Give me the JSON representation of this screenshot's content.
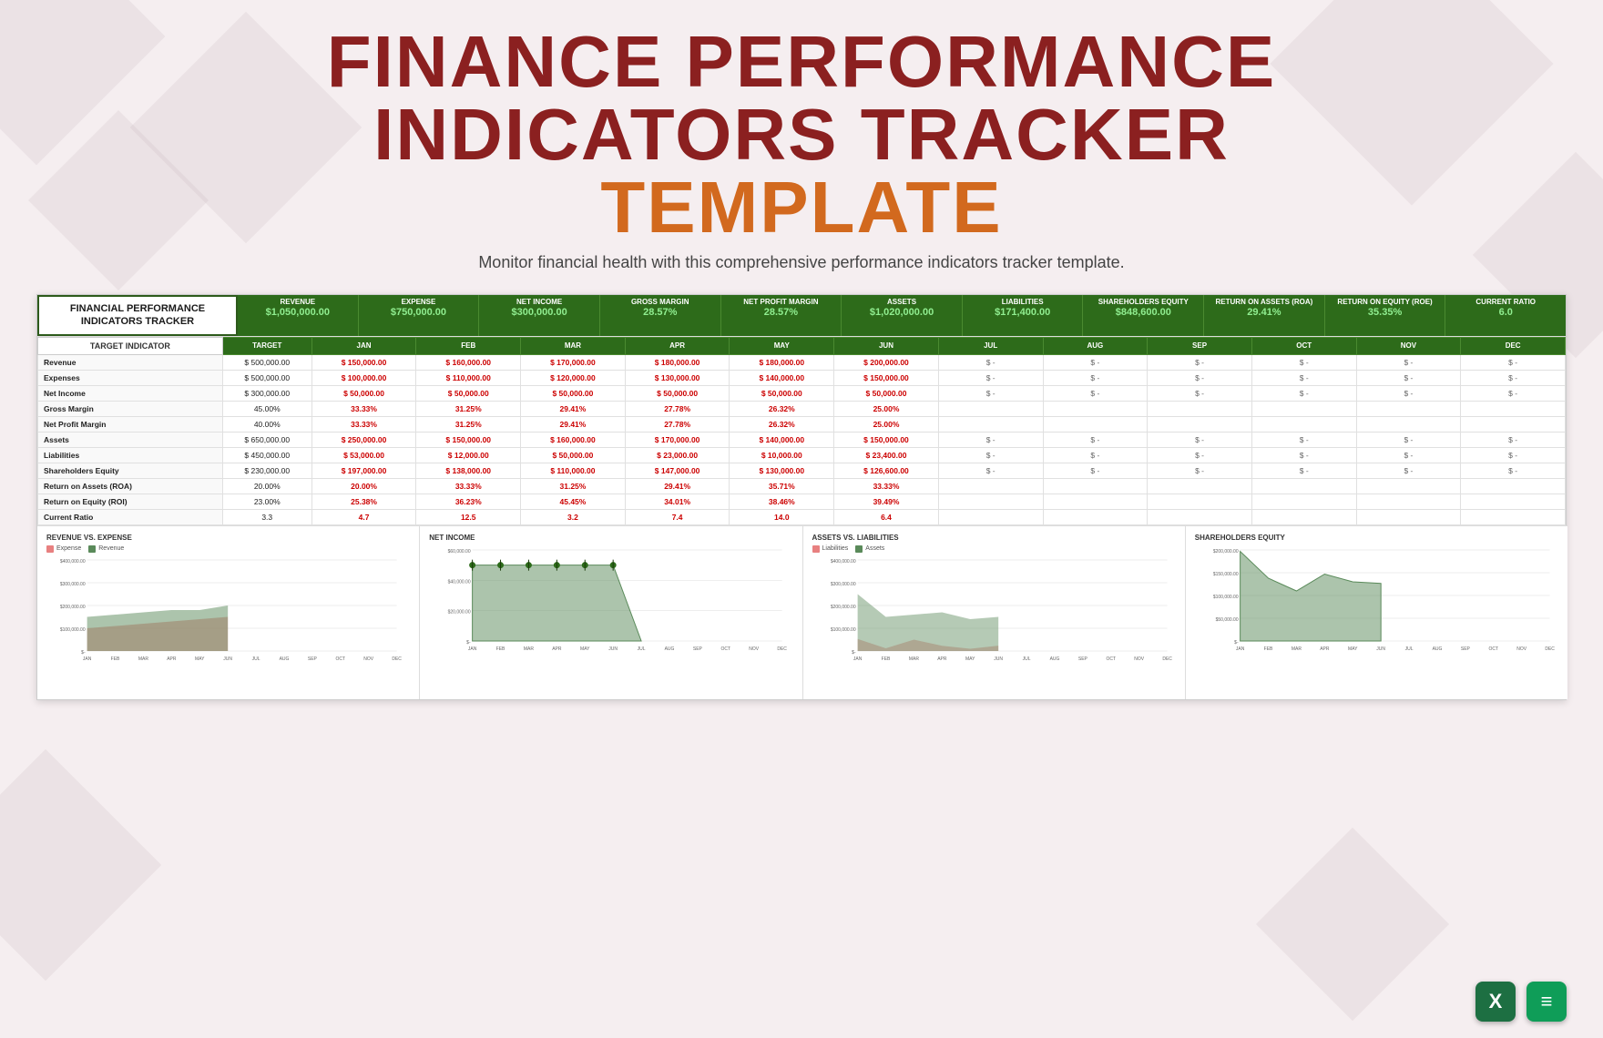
{
  "page": {
    "title_line1": "FINANCE PERFORMANCE",
    "title_line2": "INDICATORS TRACKER",
    "title_highlight": "TEMPLATE",
    "subtitle": "Monitor financial health with this comprehensive performance indicators tracker template."
  },
  "tracker_title_line1": "FINANCIAL PERFORMANCE",
  "tracker_title_line2": "INDICATORS TRACKER",
  "summary_metrics": [
    {
      "label": "REVENUE",
      "value": "$1,050,000.00"
    },
    {
      "label": "EXPENSE",
      "value": "$750,000.00"
    },
    {
      "label": "NET INCOME",
      "value": "$300,000.00"
    },
    {
      "label": "GROSS MARGIN",
      "value": "28.57%"
    },
    {
      "label": "NET PROFIT MARGIN",
      "value": "28.57%"
    },
    {
      "label": "ASSETS",
      "value": "$1,020,000.00"
    },
    {
      "label": "LIABILITIES",
      "value": "$171,400.00"
    },
    {
      "label": "SHAREHOLDERS EQUITY",
      "value": "$848,600.00"
    },
    {
      "label": "RETURN ON ASSETS (ROA)",
      "value": "29.41%"
    },
    {
      "label": "RETURN ON EQUITY (ROE)",
      "value": "35.35%"
    },
    {
      "label": "CURRENT RATIO",
      "value": "6.0"
    }
  ],
  "table_headers": {
    "indicator": "TARGET INDICATOR",
    "months": [
      "JAN",
      "FEB",
      "MAR",
      "APR",
      "MAY",
      "JUN",
      "JUL",
      "AUG",
      "SEP",
      "OCT",
      "NOV",
      "DEC"
    ]
  },
  "rows": [
    {
      "label": "Revenue",
      "target": "$ 500,000.00",
      "jan": "$ 150,000.00",
      "feb": "$ 160,000.00",
      "mar": "$ 170,000.00",
      "apr": "$ 180,000.00",
      "may": "$ 180,000.00",
      "jun": "$ 200,000.00",
      "jul": "$  -",
      "aug": "$  -",
      "sep": "$  -",
      "oct": "$  -",
      "nov": "$  -",
      "dec": "$  -",
      "type": "currency"
    },
    {
      "label": "Expenses",
      "target": "$ 500,000.00",
      "jan": "$ 100,000.00",
      "feb": "$ 110,000.00",
      "mar": "$ 120,000.00",
      "apr": "$ 130,000.00",
      "may": "$ 140,000.00",
      "jun": "$ 150,000.00",
      "jul": "$  -",
      "aug": "$  -",
      "sep": "$  -",
      "oct": "$  -",
      "nov": "$  -",
      "dec": "$  -",
      "type": "currency"
    },
    {
      "label": "Net Income",
      "target": "$ 300,000.00",
      "jan": "$ 50,000.00",
      "feb": "$ 50,000.00",
      "mar": "$ 50,000.00",
      "apr": "$ 50,000.00",
      "may": "$ 50,000.00",
      "jun": "$ 50,000.00",
      "jul": "$  -",
      "aug": "$  -",
      "sep": "$  -",
      "oct": "$  -",
      "nov": "$  -",
      "dec": "$  -",
      "type": "currency"
    },
    {
      "label": "Gross Margin",
      "target": "45.00%",
      "jan": "33.33%",
      "feb": "31.25%",
      "mar": "29.41%",
      "apr": "27.78%",
      "may": "26.32%",
      "jun": "25.00%",
      "jul": "",
      "aug": "",
      "sep": "",
      "oct": "",
      "nov": "",
      "dec": "",
      "type": "percent"
    },
    {
      "label": "Net Profit Margin",
      "target": "40.00%",
      "jan": "33.33%",
      "feb": "31.25%",
      "mar": "29.41%",
      "apr": "27.78%",
      "may": "26.32%",
      "jun": "25.00%",
      "jul": "",
      "aug": "",
      "sep": "",
      "oct": "",
      "nov": "",
      "dec": "",
      "type": "percent"
    },
    {
      "label": "Assets",
      "target": "$ 650,000.00",
      "jan": "$ 250,000.00",
      "feb": "$ 150,000.00",
      "mar": "$ 160,000.00",
      "apr": "$ 170,000.00",
      "may": "$ 140,000.00",
      "jun": "$ 150,000.00",
      "jul": "$  -",
      "aug": "$  -",
      "sep": "$  -",
      "oct": "$  -",
      "nov": "$  -",
      "dec": "$  -",
      "type": "currency"
    },
    {
      "label": "Liabilities",
      "target": "$ 450,000.00",
      "jan": "$ 53,000.00",
      "feb": "$ 12,000.00",
      "mar": "$ 50,000.00",
      "apr": "$ 23,000.00",
      "may": "$ 10,000.00",
      "jun": "$ 23,400.00",
      "jul": "$  -",
      "aug": "$  -",
      "sep": "$  -",
      "oct": "$  -",
      "nov": "$  -",
      "dec": "$  -",
      "type": "currency"
    },
    {
      "label": "Shareholders Equity",
      "target": "$ 230,000.00",
      "jan": "$ 197,000.00",
      "feb": "$ 138,000.00",
      "mar": "$ 110,000.00",
      "apr": "$ 147,000.00",
      "may": "$ 130,000.00",
      "jun": "$ 126,600.00",
      "jul": "$  -",
      "aug": "$  -",
      "sep": "$  -",
      "oct": "$  -",
      "nov": "$  -",
      "dec": "$  -",
      "type": "currency"
    },
    {
      "label": "Return on Assets (ROA)",
      "target": "20.00%",
      "jan": "20.00%",
      "feb": "33.33%",
      "mar": "31.25%",
      "apr": "29.41%",
      "may": "35.71%",
      "jun": "33.33%",
      "jul": "",
      "aug": "",
      "sep": "",
      "oct": "",
      "nov": "",
      "dec": "",
      "type": "percent"
    },
    {
      "label": "Return on Equity (ROI)",
      "target": "23.00%",
      "jan": "25.38%",
      "feb": "36.23%",
      "mar": "45.45%",
      "apr": "34.01%",
      "may": "38.46%",
      "jun": "39.49%",
      "jul": "",
      "aug": "",
      "sep": "",
      "oct": "",
      "nov": "",
      "dec": "",
      "type": "percent"
    },
    {
      "label": "Current Ratio",
      "target": "3.3",
      "jan": "4.7",
      "feb": "12.5",
      "mar": "3.2",
      "apr": "7.4",
      "may": "14.0",
      "jun": "6.4",
      "jul": "",
      "aug": "",
      "sep": "",
      "oct": "",
      "nov": "",
      "dec": "",
      "type": "ratio"
    }
  ],
  "charts": [
    {
      "title": "REVENUE VS. EXPENSE",
      "legend": [
        {
          "label": "Expense",
          "color": "#e88080"
        },
        {
          "label": "Revenue",
          "color": "#5a8a5a"
        }
      ],
      "y_labels": [
        "$400,000.00",
        "$300,000.00",
        "$200,000.00",
        "$100,000.00",
        "$-"
      ],
      "x_labels": [
        "JAN",
        "FEB",
        "MAR",
        "APR",
        "MAY",
        "JUN",
        "JUL",
        "AUG",
        "SEP",
        "OCT",
        "NOV",
        "DEC"
      ]
    },
    {
      "title": "NET INCOME",
      "y_labels": [
        "$60,000.00",
        "$40,000.00",
        "$20,000.00",
        "$-"
      ],
      "x_labels": [
        "JAN",
        "FEB",
        "MAR",
        "APR",
        "MAY",
        "JUN",
        "JUL",
        "AUG",
        "SEP",
        "OCT",
        "NOV",
        "DEC"
      ]
    },
    {
      "title": "ASSETS VS. LIABILITIES",
      "legend": [
        {
          "label": "Liabilities",
          "color": "#e88080"
        },
        {
          "label": "Assets",
          "color": "#5a8a5a"
        }
      ],
      "y_labels": [
        "$400,000.00",
        "$300,000.00",
        "$200,000.00",
        "$100,000.00",
        "$-"
      ],
      "x_labels": [
        "JAN",
        "FEB",
        "MAR",
        "APR",
        "MAY",
        "JUN",
        "JUL",
        "AUG",
        "SEP",
        "OCT",
        "NOV",
        "DEC"
      ]
    },
    {
      "title": "SHAREHOLDERS EQUITY",
      "y_labels": [
        "$200,000.00",
        "$150,000.00",
        "$100,000.00",
        "$50,000.00",
        "$-"
      ],
      "x_labels": [
        "JAN",
        "FEB",
        "MAR",
        "APR",
        "MAY",
        "JUN",
        "JUL",
        "AUG",
        "SEP",
        "OCT",
        "NOV",
        "DEC"
      ]
    }
  ],
  "icons": [
    {
      "name": "Excel",
      "symbol": "X",
      "bg": "#1d6f42"
    },
    {
      "name": "Google Sheets",
      "symbol": "≡",
      "bg": "#0f9d58"
    }
  ]
}
